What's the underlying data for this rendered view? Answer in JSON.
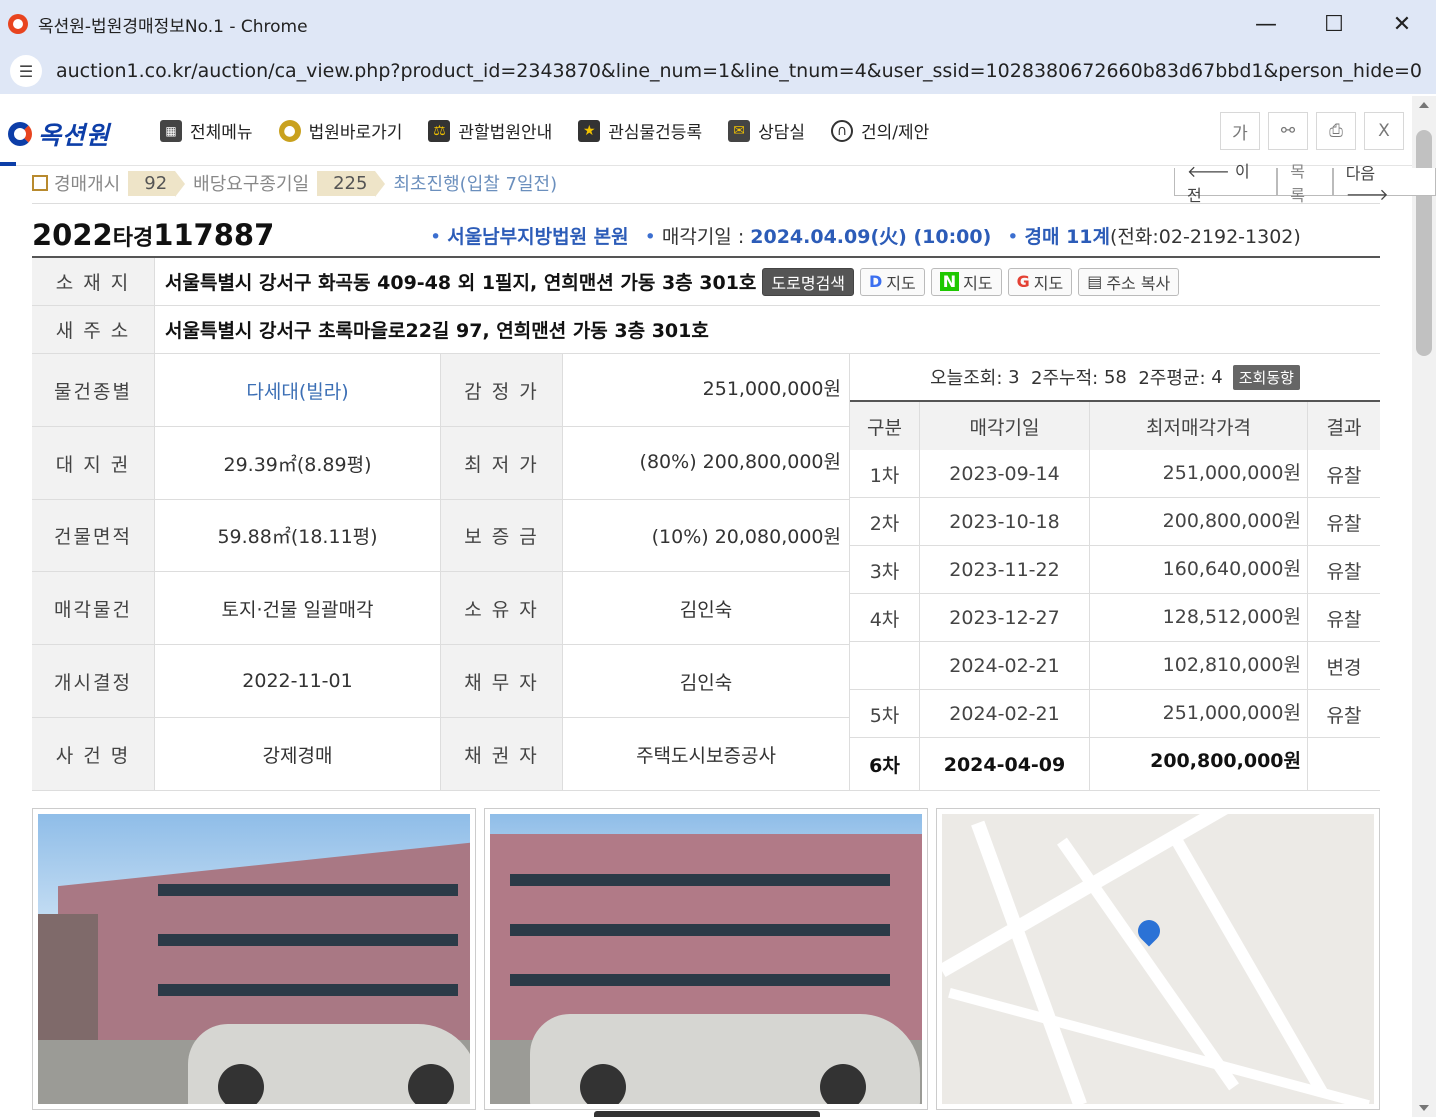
{
  "window": {
    "title": "옥션원-법원경매정보No.1 - Chrome",
    "url": "auction1.co.kr/auction/ca_view.php?product_id=2343870&line_num=1&line_tnum=4&user_ssid=1028380672660b83d67bbd1&person_hide=0",
    "minimize": "—",
    "maximize": "☐",
    "close": "✕"
  },
  "header": {
    "logo": "옥션원",
    "menu": [
      {
        "label": "전체메뉴",
        "icon": "grid-icon"
      },
      {
        "label": "법원바로가기",
        "icon": "globe-icon"
      },
      {
        "label": "관할법원안내",
        "icon": "gavel-icon"
      },
      {
        "label": "관심물건등록",
        "icon": "star-folder-icon"
      },
      {
        "label": "상담실",
        "icon": "chat-icon"
      },
      {
        "label": "건의/제안",
        "icon": "headset-icon"
      }
    ],
    "tools": {
      "font": "가",
      "share": "⚯",
      "print": "⎙",
      "close": "X"
    }
  },
  "progress": {
    "start_label": "경매개시",
    "start_count": "92",
    "claim_label": "배당요구종기일",
    "claim_count": "225",
    "current": "최초진행(입찰 7일전)"
  },
  "nav": {
    "prev": "🡐 이전",
    "list": "목록",
    "next": "다음 🡒"
  },
  "case": {
    "year": "2022",
    "type": "타경",
    "number": "117887",
    "court": "서울남부지방법원 본원",
    "sale_label": "매각기일 : ",
    "sale_date": "2024.04.09(火) (10:00)",
    "dept": "경매 11계",
    "phone": "(전화:02-2192-1302)"
  },
  "address": {
    "label": "소 재 지",
    "value": "서울특별시 강서구 화곡동 409-48 외 1필지, 연희맨션 가동 3층 301호",
    "btn_road": "도로명검색",
    "btn_daum": "지도",
    "btn_naver": "지도",
    "btn_google": "지도",
    "btn_copy": "주소 복사",
    "new_label": "새 주 소",
    "new_value": "서울특별시 강서구 초록마을로22길 97, 연희맨션 가동 3층 301호"
  },
  "details": [
    {
      "l1": "물건종별",
      "v1": "다세대(빌라)",
      "l2": "감 정 가",
      "v2": "251,000,000원"
    },
    {
      "l1": "대 지 권",
      "v1": "29.39㎡(8.89평)",
      "l2": "최 저 가",
      "v2": "(80%) 200,800,000원"
    },
    {
      "l1": "건물면적",
      "v1": "59.88㎡(18.11평)",
      "l2": "보 증 금",
      "v2": "(10%) 20,080,000원"
    },
    {
      "l1": "매각물건",
      "v1": "토지·건물 일괄매각",
      "l2": "소 유 자",
      "v2": "김인숙"
    },
    {
      "l1": "개시결정",
      "v1": "2022-11-01",
      "l2": "채 무 자",
      "v2": "김인숙"
    },
    {
      "l1": "사 건 명",
      "v1": "강제경매",
      "l2": "채 권 자",
      "v2": "주택도시보증공사"
    }
  ],
  "stats": {
    "today_label": "오늘조회:",
    "today": "3",
    "twoweek_label": "2주누적:",
    "twoweek": "58",
    "avg_label": "2주평균:",
    "avg": "4",
    "btn": "조회동향"
  },
  "history": {
    "headers": [
      "구분",
      "매각기일",
      "최저매각가격",
      "결과"
    ],
    "rows": [
      {
        "round": "1차",
        "date": "2023-09-14",
        "price": "251,000,000원",
        "result": "유찰"
      },
      {
        "round": "2차",
        "date": "2023-10-18",
        "price": "200,800,000원",
        "result": "유찰"
      },
      {
        "round": "3차",
        "date": "2023-11-22",
        "price": "160,640,000원",
        "result": "유찰"
      },
      {
        "round": "4차",
        "date": "2023-12-27",
        "price": "128,512,000원",
        "result": "유찰"
      },
      {
        "round": "",
        "date": "2024-02-21",
        "price": "102,810,000원",
        "result": "변경"
      },
      {
        "round": "5차",
        "date": "2024-02-21",
        "price": "251,000,000원",
        "result": "유찰"
      },
      {
        "round": "6차",
        "date": "2024-04-09",
        "price": "200,800,000원",
        "result": ""
      }
    ]
  }
}
